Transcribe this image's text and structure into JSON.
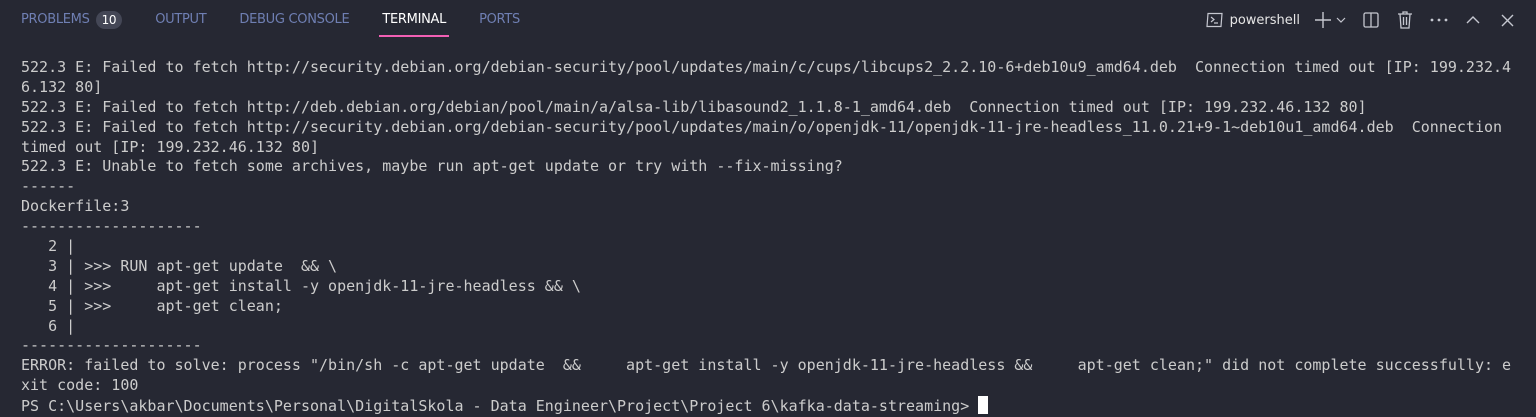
{
  "panel": {
    "tabs": [
      {
        "label": "PROBLEMS",
        "badge": "10"
      },
      {
        "label": "OUTPUT"
      },
      {
        "label": "DEBUG CONSOLE"
      },
      {
        "label": "TERMINAL",
        "active": true
      },
      {
        "label": "PORTS"
      }
    ],
    "toolbar": {
      "shell_label": "powershell",
      "icons": [
        "terminal-icon",
        "plus-icon",
        "chevron-down-icon",
        "split-icon",
        "trash-icon",
        "more-icon",
        "chevron-up-icon",
        "close-icon"
      ]
    }
  },
  "terminal": {
    "lines": [
      "522.3 E: Failed to fetch http://security.debian.org/debian-security/pool/updates/main/c/cups/libcups2_2.2.10-6+deb10u9_amd64.deb  Connection timed out [IP: 199.232.4",
      "6.132 80]",
      "522.3 E: Failed to fetch http://deb.debian.org/debian/pool/main/a/alsa-lib/libasound2_1.1.8-1_amd64.deb  Connection timed out [IP: 199.232.46.132 80]",
      "522.3 E: Failed to fetch http://security.debian.org/debian-security/pool/updates/main/o/openjdk-11/openjdk-11-jre-headless_11.0.21+9-1~deb10u1_amd64.deb  Connection",
      "timed out [IP: 199.232.46.132 80]",
      "522.3 E: Unable to fetch some archives, maybe run apt-get update or try with --fix-missing?",
      "------",
      "Dockerfile:3",
      "--------------------",
      "   2 |",
      "   3 | >>> RUN apt-get update  && \\",
      "   4 | >>>     apt-get install -y openjdk-11-jre-headless && \\",
      "   5 | >>>     apt-get clean;",
      "   6 |",
      "--------------------",
      "ERROR: failed to solve: process \"/bin/sh -c apt-get update  &&     apt-get install -y openjdk-11-jre-headless &&     apt-get clean;\" did not complete successfully: e",
      "xit code: 100"
    ],
    "prompt": "PS C:\\Users\\akbar\\Documents\\Personal\\DigitalSkola - Data Engineer\\Project\\Project 6\\kafka-data-streaming>"
  },
  "colors": {
    "background": "#262833",
    "text": "#cccccc",
    "active_tab_underline": "#f25fb4",
    "inactive_tab": "#6f7fb3"
  }
}
